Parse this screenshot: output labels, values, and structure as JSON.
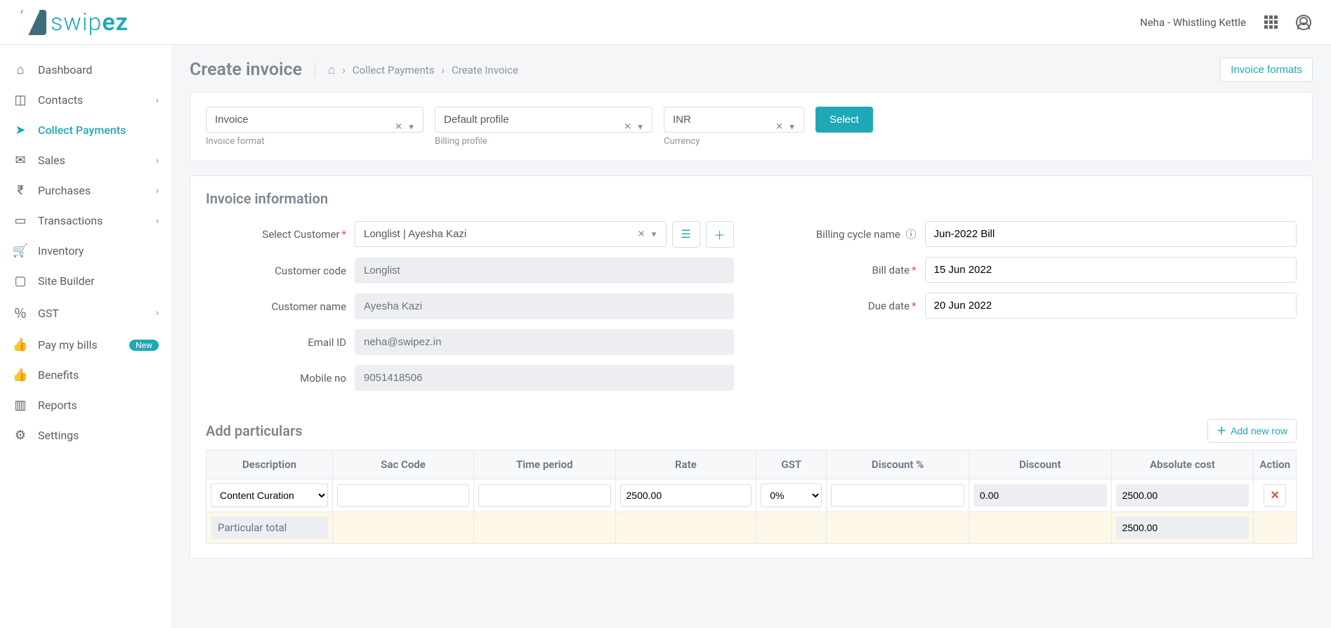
{
  "header": {
    "logo_text_a": "swip",
    "logo_text_b": "ez",
    "user_name": "Neha - Whistling Kettle"
  },
  "sidebar": {
    "items": [
      {
        "label": "Dashboard",
        "icon": "home",
        "expandable": false
      },
      {
        "label": "Contacts",
        "icon": "contact",
        "expandable": true
      },
      {
        "label": "Collect Payments",
        "icon": "rocket",
        "expandable": false,
        "active": true
      },
      {
        "label": "Sales",
        "icon": "mail",
        "expandable": true
      },
      {
        "label": "Purchases",
        "icon": "rupee",
        "expandable": true
      },
      {
        "label": "Transactions",
        "icon": "cash",
        "expandable": true
      },
      {
        "label": "Inventory",
        "icon": "cart",
        "expandable": false
      },
      {
        "label": "Site Builder",
        "icon": "site",
        "expandable": false
      },
      {
        "label": "GST",
        "icon": "percent",
        "expandable": true
      },
      {
        "label": "Pay my bills",
        "icon": "thumb",
        "expandable": false,
        "badge": "New"
      },
      {
        "label": "Benefits",
        "icon": "thumb",
        "expandable": false
      },
      {
        "label": "Reports",
        "icon": "chart",
        "expandable": false
      },
      {
        "label": "Settings",
        "icon": "gear",
        "expandable": false
      }
    ]
  },
  "page": {
    "title": "Create invoice",
    "breadcrumb": {
      "mid": "Collect Payments",
      "last": "Create Invoice"
    },
    "formats_btn": "Invoice formats"
  },
  "toolbar": {
    "invoice_format": {
      "value": "Invoice",
      "label": "Invoice format"
    },
    "billing_profile": {
      "value": "Default profile",
      "label": "Billing profile"
    },
    "currency": {
      "value": "INR",
      "label": "Currency"
    },
    "select_btn": "Select"
  },
  "invoice_info": {
    "title": "Invoice information",
    "select_customer_label": "Select Customer",
    "customer_value": "Longlist | Ayesha Kazi",
    "customer_code_label": "Customer code",
    "customer_code": "Longlist",
    "customer_name_label": "Customer name",
    "customer_name": "Ayesha Kazi",
    "email_label": "Email ID",
    "email": "neha@swipez.in",
    "mobile_label": "Mobile no",
    "mobile": "9051418506",
    "billing_cycle_label": "Billing cycle name",
    "billing_cycle": "Jun-2022 Bill",
    "bill_date_label": "Bill date",
    "bill_date": "15 Jun 2022",
    "due_date_label": "Due date",
    "due_date": "20 Jun 2022"
  },
  "particulars": {
    "title": "Add particulars",
    "add_btn": "Add new row",
    "columns": [
      "Description",
      "Sac Code",
      "Time period",
      "Rate",
      "GST",
      "Discount %",
      "Discount",
      "Absolute cost",
      "Action"
    ],
    "row": {
      "description": "Content Curation",
      "sac": "",
      "period": "",
      "rate": "2500.00",
      "gst": "0%",
      "disc_pct": "",
      "discount": "0.00",
      "absolute": "2500.00"
    },
    "total_label": "Particular total",
    "total": "2500.00"
  }
}
